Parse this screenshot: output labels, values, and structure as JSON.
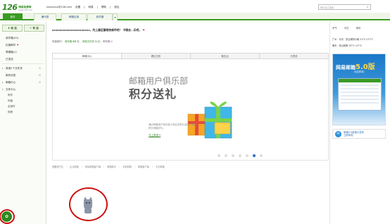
{
  "logo": {
    "number": "126",
    "title": "网易免费邮",
    "subtitle": "www.126.com"
  },
  "account": {
    "email": "sxxxxxxx@126.com",
    "items": [
      "设置",
      "|",
      "网易",
      "|",
      "帮助",
      "|",
      "退出"
    ]
  },
  "search": {
    "placeholder": "邮件全文搜索"
  },
  "tabs": [
    "首页",
    "通讯录",
    "邮箱应用",
    "收件箱"
  ],
  "sidebar": {
    "receive": "收 信",
    "write": "写 信",
    "folders": [
      {
        "label": "收件箱",
        "count": "(43)"
      },
      {
        "label": "红旗邮件",
        "count": ""
      },
      {
        "label": "草稿箱",
        "count": "(1)"
      },
      {
        "label": "已发送",
        "count": ""
      }
    ],
    "groups": [
      {
        "label": "其他2个文件夹"
      },
      {
        "label": "邮件标签"
      },
      {
        "label": "邮箱中心"
      },
      {
        "label": "文件中心"
      }
    ],
    "sub_items": [
      "附件",
      "网盘",
      "全部件",
      "相册"
    ]
  },
  "main": {
    "greeting": "sxxxxxxxxxxxxxxxxxxxxx，约上最近最畅快邮件吧！ 今晚去…乐吧，",
    "stats_prefix": "快速操作：",
    "stats_unread_label": "收件箱",
    "stats_unread": "43",
    "stats_unread_unit": "封，",
    "stats_other_label": "其他文件夹",
    "stats_other": "1",
    "stats_other_unit": "封；",
    "stats_ad": "邮件箱",
    "stats_ad_num": "0",
    "panel_tabs": [
      "邮箱中心",
      "看见日历",
      "微生活",
      "乐意说"
    ],
    "promo_title": "邮箱用户俱乐部",
    "promo_big": "积分送礼",
    "promo_desc": "通过邮箱用户俱乐部小说会员积分活动，你的积分领取好礼。",
    "promo_link": "马上参加!!",
    "foot_links": [
      "提醒快不忘",
      "企业邮箱",
      "网易邮箱客户端",
      "邮箱助手",
      "手机邮箱",
      "邮箱客户端",
      "中文邮箱"
    ]
  },
  "right": {
    "tabs": [
      "天气",
      "今日",
      "资讯"
    ],
    "weather1": "广州  ·  今天：多云转阴小雨  21°C～27°C",
    "weather2": "明天：多云转阴  19°C～27°C",
    "ad_title": "网易邮箱",
    "ad_version": "5.0版",
    "ad_sub": "欢迎体验！",
    "ad_link_line1": "邮箱5.0新版已发布",
    "ad_link_line2": "立即体验"
  }
}
